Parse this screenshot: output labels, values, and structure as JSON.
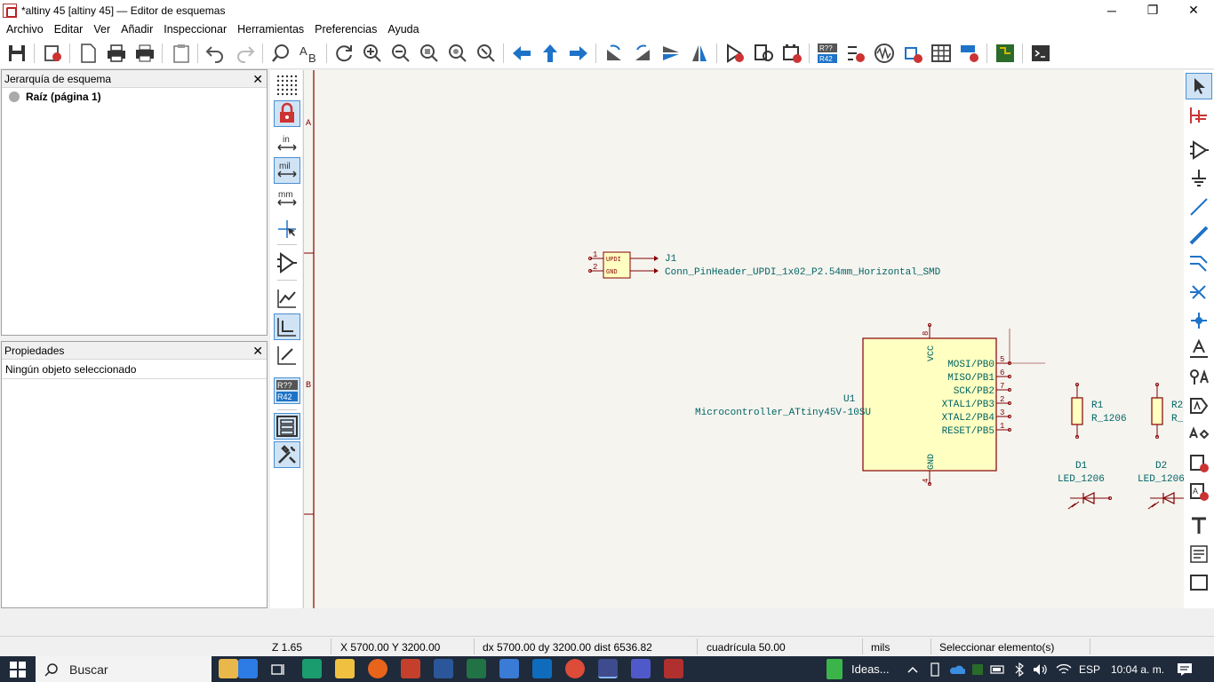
{
  "window": {
    "title": "*altiny 45 [altiny 45] — Editor de esquemas",
    "minimize": "─",
    "maximize": "❐",
    "close": "✕"
  },
  "menu": [
    "Archivo",
    "Editar",
    "Ver",
    "Añadir",
    "Inspeccionar",
    "Herramientas",
    "Preferencias",
    "Ayuda"
  ],
  "hierarchy": {
    "title": "Jerarquía de esquema",
    "close": "✕",
    "root": "Raíz (página 1)"
  },
  "properties": {
    "title": "Propiedades",
    "close": "✕",
    "empty": "Ningún objeto seleccionado"
  },
  "grid_units": {
    "in": "in",
    "mil": "mil",
    "mm": "mm",
    "annotate_top": "R??",
    "annotate_bottom": "R42"
  },
  "toolbar_annotate": {
    "top": "R??",
    "bottom": "R42"
  },
  "schematic": {
    "border_labels": [
      "A",
      "B"
    ],
    "j1": {
      "ref": "J1",
      "value": "Conn_PinHeader_UPDI_1x02_P2.54mm_Horizontal_SMD",
      "pin1": "UPDI",
      "pin2": "GND",
      "num1": "1",
      "num2": "2"
    },
    "u1": {
      "ref": "U1",
      "value": "Microcontroller_ATtiny45V-10SU",
      "vcc": "VCC",
      "gnd": "GND",
      "vcc_pin": "8",
      "gnd_pin": "4",
      "pins": [
        {
          "name": "MOSI/PB0",
          "num": "5"
        },
        {
          "name": "MISO/PB1",
          "num": "6"
        },
        {
          "name": "SCK/PB2",
          "num": "7"
        },
        {
          "name": "XTAL1/PB3",
          "num": "2"
        },
        {
          "name": "XTAL2/PB4",
          "num": "3"
        },
        {
          "name": "RESET/PB5",
          "num": "1"
        }
      ]
    },
    "r1": {
      "ref": "R1",
      "value": "R_1206"
    },
    "r2": {
      "ref": "R2",
      "value": "R_"
    },
    "d1": {
      "ref": "D1",
      "value": "LED_1206"
    },
    "d2": {
      "ref": "D2",
      "value": "LED_1206"
    }
  },
  "status": {
    "zoom": "Z 1.65",
    "coords": "X 5700.00  Y 3200.00",
    "delta": "dx 5700.00  dy 3200.00  dist 6536.82",
    "grid": "cuadrícula 50.00",
    "units": "mils",
    "mode": "Seleccionar elemento(s)"
  },
  "taskbar": {
    "search": "Buscar",
    "ideas": "Ideas...",
    "language": "ESP",
    "time": "10:04 a. m."
  },
  "colors": {
    "wire": "#840000",
    "symbol_fill": "#ffffc2",
    "text_teal": "#006464",
    "accent": "#4a8fd1",
    "canvas_bg": "#f5f4ef"
  }
}
